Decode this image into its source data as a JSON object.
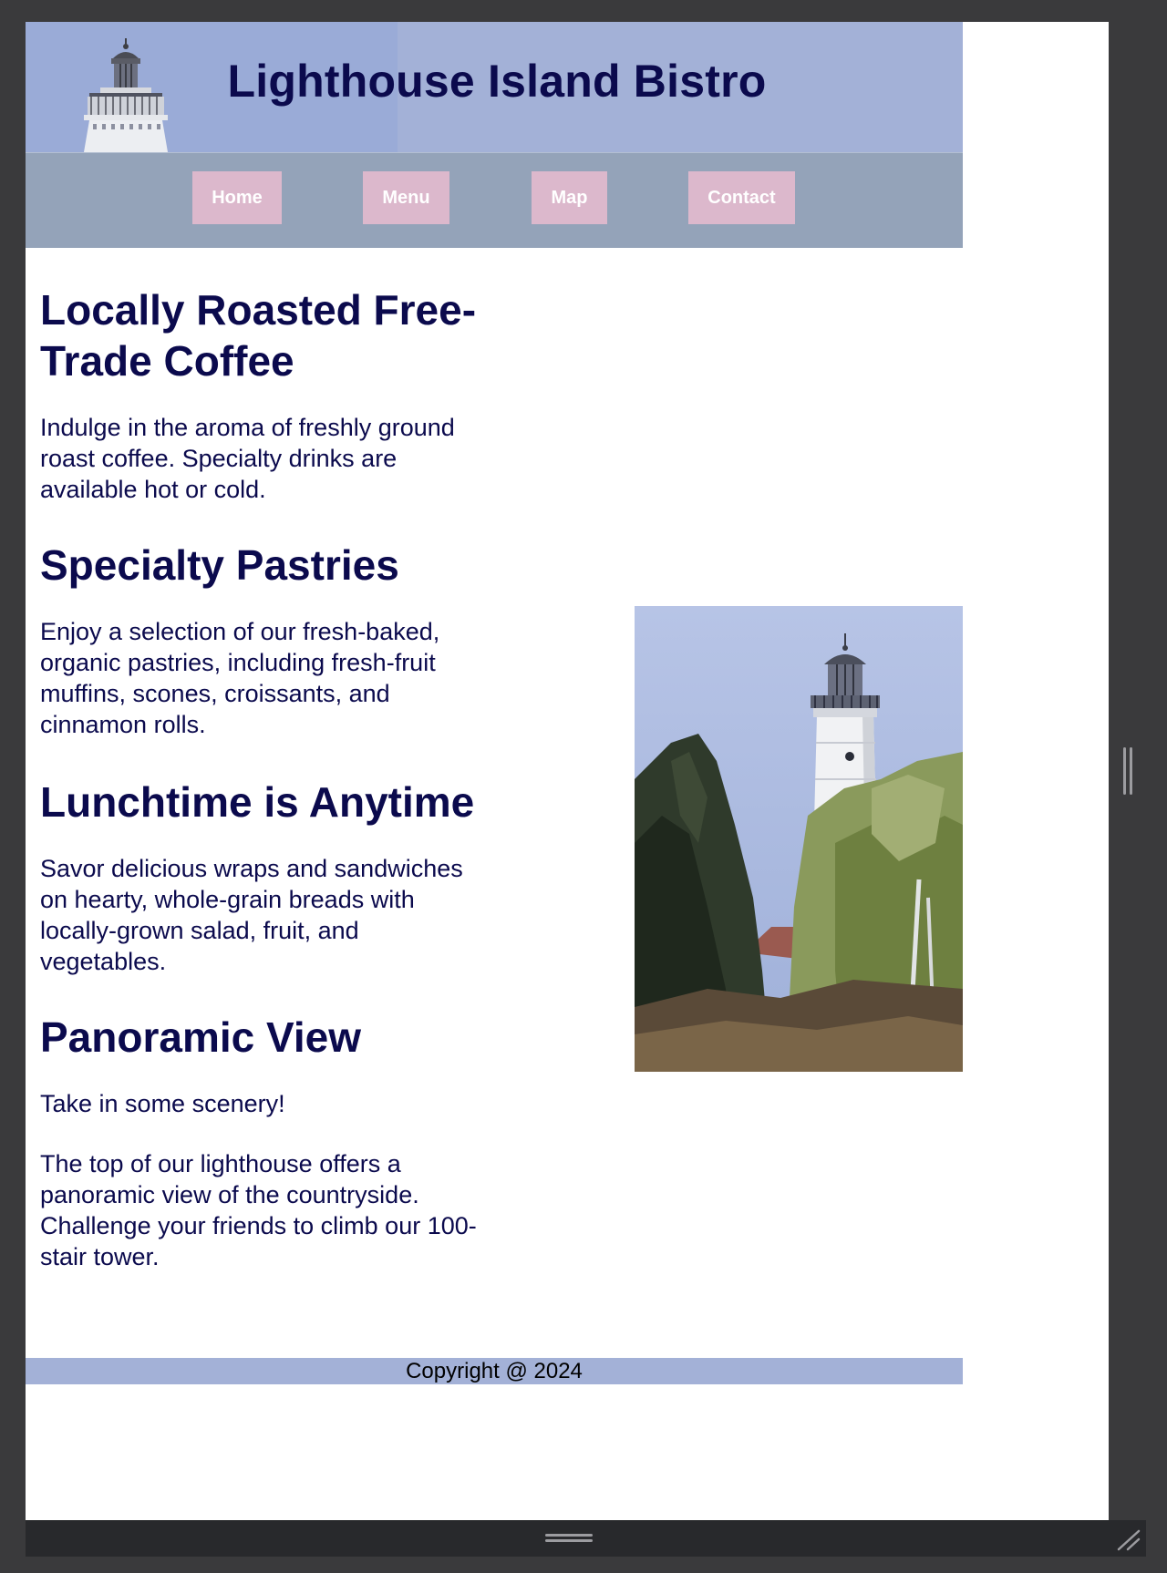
{
  "header": {
    "title": "Lighthouse Island Bistro"
  },
  "nav": {
    "items": [
      {
        "label": "Home"
      },
      {
        "label": "Menu"
      },
      {
        "label": "Map"
      },
      {
        "label": "Contact"
      }
    ]
  },
  "sections": [
    {
      "heading": "Locally Roasted Free-Trade Coffee",
      "paragraphs": [
        "Indulge in the aroma of freshly ground roast coffee. Specialty drinks are available hot or cold."
      ]
    },
    {
      "heading": "Specialty Pastries",
      "paragraphs": [
        "Enjoy a selection of our fresh-baked, organic pastries, including fresh-fruit muffins, scones, croissants, and cinnamon rolls."
      ]
    },
    {
      "heading": "Lunchtime is Anytime",
      "paragraphs": [
        "Savor delicious wraps and sandwiches on hearty, whole-grain breads with locally-grown salad, fruit, and vegetables."
      ]
    },
    {
      "heading": "Panoramic View",
      "paragraphs": [
        "Take in some scenery!",
        "The top of our lighthouse offers a panoramic view of the countryside. Challenge your friends to climb our 100-stair tower."
      ]
    }
  ],
  "footer": {
    "text": "Copyright @ 2024"
  },
  "colors": {
    "title_text": "#0b0a4d",
    "header_bg": "#a3b1d7",
    "nav_bg": "#94a3b9",
    "nav_button_bg": "#dcb8cc",
    "nav_button_text": "#ffffff",
    "footer_bg": "#a3b1d7",
    "chrome_bg": "#3a3a3c"
  },
  "icons": {
    "header_image": "lighthouse-top-image",
    "side_image": "lighthouse-photo",
    "vertical_handle": "vertical-resize-handle-icon",
    "horizontal_handle": "horizontal-resize-handle-icon",
    "corner": "resize-corner-icon"
  }
}
